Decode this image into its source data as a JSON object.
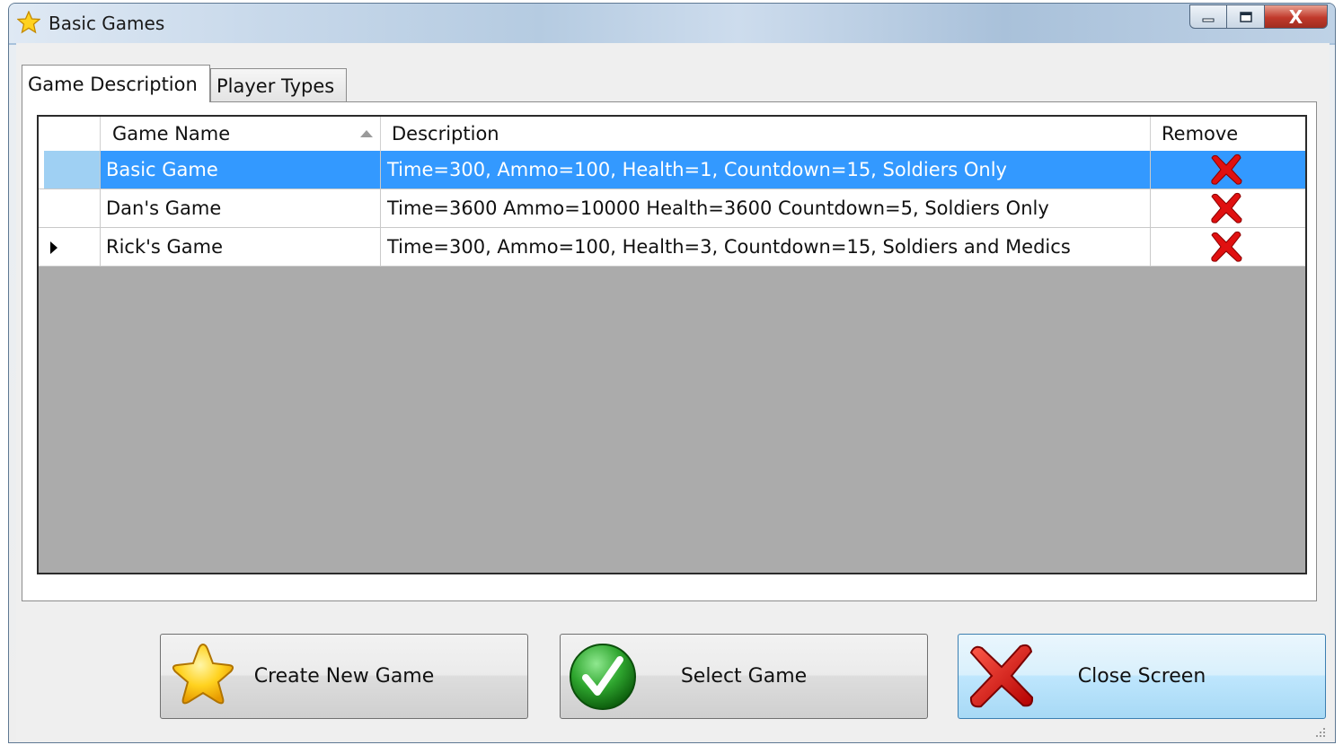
{
  "window": {
    "title": "Basic Games",
    "icon": "star-icon",
    "controls": {
      "minimize_icon": "minimize-icon",
      "maximize_icon": "maximize-icon",
      "close_label": "X"
    }
  },
  "tabs": [
    {
      "label": "Game Description",
      "active": true
    },
    {
      "label": "Player Types",
      "active": false
    }
  ],
  "grid": {
    "columns": {
      "name": "Game Name",
      "description": "Description",
      "remove": "Remove"
    },
    "sort": {
      "column": "Game Name",
      "direction": "ascending"
    },
    "rows": [
      {
        "name": "Basic Game",
        "description": "Time=300, Ammo=100, Health=1, Countdown=15, Soldiers Only",
        "selected": true,
        "current": false,
        "remove_icon": "red-x-icon"
      },
      {
        "name": "Dan's Game",
        "description": "Time=3600 Ammo=10000 Health=3600 Countdown=5, Soldiers Only",
        "selected": false,
        "current": false,
        "remove_icon": "red-x-icon"
      },
      {
        "name": "Rick's Game",
        "description": "Time=300, Ammo=100, Health=3, Countdown=15, Soldiers and Medics",
        "selected": false,
        "current": true,
        "remove_icon": "red-x-icon"
      }
    ]
  },
  "buttons": {
    "create": {
      "label": "Create New Game",
      "icon": "star-icon"
    },
    "select": {
      "label": "Select Game",
      "icon": "green-check-icon"
    },
    "close": {
      "label": "Close Screen",
      "icon": "red-x-icon"
    }
  },
  "colors": {
    "selection": "#3399ff",
    "grid_background": "#ababab",
    "remove_red": "#e01010",
    "check_green": "#2fa62f",
    "star_yellow": "#ffd21f"
  }
}
